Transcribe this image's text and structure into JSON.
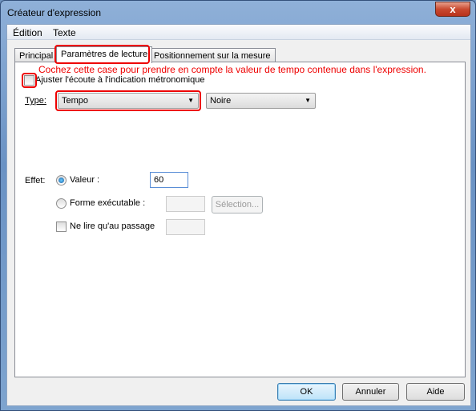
{
  "window": {
    "title": "Créateur d'expression",
    "close_glyph": "x"
  },
  "menu": [
    "Édition",
    "Texte"
  ],
  "tabs": [
    "Principal",
    "Paramètres de lecture",
    "Positionnement sur la mesure"
  ],
  "annotation": "Cochez cette case pour prendre en compte la valeur de tempo contenue dans l'expression.",
  "adjust_checkbox": {
    "label": "Ajuster l'écoute à l'indication métronomique",
    "checked": false
  },
  "type": {
    "label": "Type:",
    "value": "Tempo",
    "unit_value": "Noire"
  },
  "effect": {
    "label": "Effet:",
    "valeur_label": "Valeur :",
    "valeur": "60",
    "forme_label": "Forme exécutable :",
    "selection_label": "Sélection...",
    "passage_label": "Ne lire qu'au passage",
    "selected": "Valeur"
  },
  "buttons": {
    "ok": "OK",
    "cancel": "Annuler",
    "help": "Aide"
  },
  "colors": {
    "highlight": "#e00000"
  }
}
